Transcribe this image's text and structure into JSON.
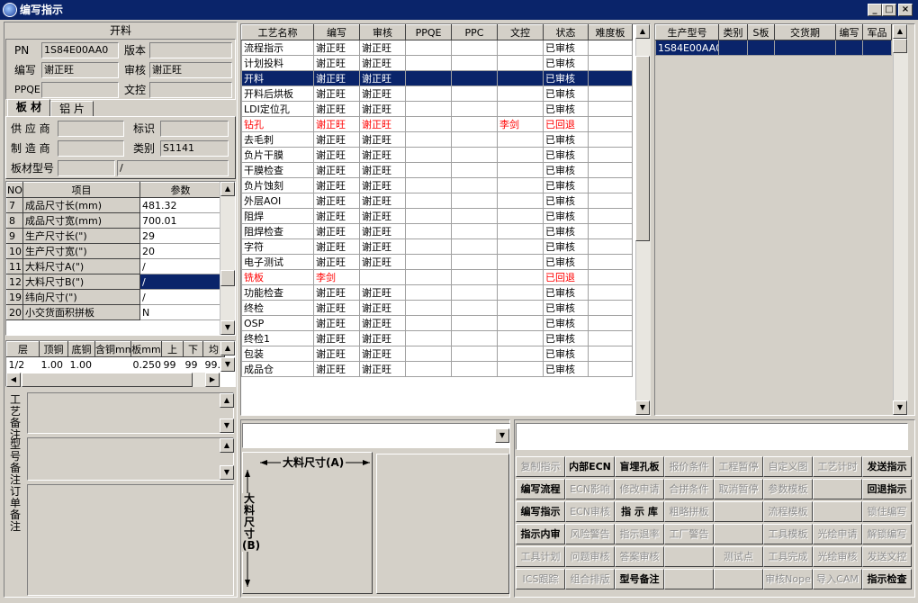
{
  "window": {
    "title": "编写指示",
    "min_label": "_",
    "max_label": "□",
    "close_label": "×"
  },
  "left": {
    "section_title": "开料",
    "pn_label": "PN",
    "pn_value": "1S84E00AA0",
    "version_label": "版本",
    "version_value": "",
    "writer_label": "编写",
    "writer_value": "谢正旺",
    "reviewer_label": "审核",
    "reviewer_value": "谢正旺",
    "ppqe_label": "PPQE",
    "ppqe_value": "",
    "doccontrol_label": "文控",
    "doccontrol_value": "",
    "tabs": [
      {
        "label": "板 材"
      },
      {
        "label": "铝 片"
      }
    ],
    "supplier_label": "供 应 商",
    "supplier_value": "",
    "mark_label": "标识",
    "mark_value": "",
    "maker_label": "制 造 商",
    "maker_value": "",
    "category_label": "类别",
    "category_value": "S1141",
    "board_model_label": "板材型号",
    "board_model_value": "",
    "board_model_value2": "/",
    "param_headers": [
      "NO",
      "项目",
      "参数"
    ],
    "params": [
      {
        "no": "7",
        "item": "成品尺寸长(mm)",
        "value": "481.32"
      },
      {
        "no": "8",
        "item": "成品尺寸宽(mm)",
        "value": "700.01"
      },
      {
        "no": "9",
        "item": "生产尺寸长(\")",
        "value": "29"
      },
      {
        "no": "10",
        "item": "生产尺寸宽(\")",
        "value": "20"
      },
      {
        "no": "11",
        "item": "大料尺寸A(\")",
        "value": "/"
      },
      {
        "no": "12",
        "item": "大料尺寸B(\")",
        "value": "/"
      },
      {
        "no": "19",
        "item": "纬向尺寸(\")",
        "value": "/"
      },
      {
        "no": "20",
        "item": "小交货面积拼板",
        "value": "N"
      }
    ],
    "layer_headers": [
      "层",
      "顶铜",
      "底铜",
      "含铜mm",
      "板mm",
      "上",
      "下",
      "均"
    ],
    "layers": [
      {
        "c0": "1/2",
        "c1": "1.00",
        "c2": "1.00",
        "c3": "",
        "c4": "0.250",
        "c5": "99",
        "c6": "99",
        "c7": "99."
      }
    ],
    "notes": [
      {
        "label": "工艺备注"
      },
      {
        "label": "型号备注"
      },
      {
        "label": "订单备注"
      }
    ]
  },
  "process": {
    "headers": [
      "工艺名称",
      "编写",
      "审核",
      "PPQE",
      "PPC",
      "文控",
      "状态",
      "难度板"
    ],
    "rows": [
      {
        "name": "流程指示",
        "writer": "谢正旺",
        "reviewer": "谢正旺",
        "ppqe": "",
        "ppc": "",
        "doc": "",
        "status": "已审核",
        "diff": ""
      },
      {
        "name": "计划投料",
        "writer": "谢正旺",
        "reviewer": "谢正旺",
        "ppqe": "",
        "ppc": "",
        "doc": "",
        "status": "已审核",
        "diff": ""
      },
      {
        "name": "开料",
        "writer": "谢正旺",
        "reviewer": "谢正旺",
        "ppqe": "",
        "ppc": "",
        "doc": "",
        "status": "已审核",
        "diff": ""
      },
      {
        "name": "开料后烘板",
        "writer": "谢正旺",
        "reviewer": "谢正旺",
        "ppqe": "",
        "ppc": "",
        "doc": "",
        "status": "已审核",
        "diff": ""
      },
      {
        "name": "LDI定位孔",
        "writer": "谢正旺",
        "reviewer": "谢正旺",
        "ppqe": "",
        "ppc": "",
        "doc": "",
        "status": "已审核",
        "diff": ""
      },
      {
        "name": "钻孔",
        "writer": "谢正旺",
        "reviewer": "谢正旺",
        "ppqe": "",
        "ppc": "",
        "doc": "李剑",
        "status": "已回退",
        "diff": ""
      },
      {
        "name": "去毛刺",
        "writer": "谢正旺",
        "reviewer": "谢正旺",
        "ppqe": "",
        "ppc": "",
        "doc": "",
        "status": "已审核",
        "diff": ""
      },
      {
        "name": "负片干膜",
        "writer": "谢正旺",
        "reviewer": "谢正旺",
        "ppqe": "",
        "ppc": "",
        "doc": "",
        "status": "已审核",
        "diff": ""
      },
      {
        "name": "干膜检查",
        "writer": "谢正旺",
        "reviewer": "谢正旺",
        "ppqe": "",
        "ppc": "",
        "doc": "",
        "status": "已审核",
        "diff": ""
      },
      {
        "name": "负片蚀刻",
        "writer": "谢正旺",
        "reviewer": "谢正旺",
        "ppqe": "",
        "ppc": "",
        "doc": "",
        "status": "已审核",
        "diff": ""
      },
      {
        "name": "外层AOI",
        "writer": "谢正旺",
        "reviewer": "谢正旺",
        "ppqe": "",
        "ppc": "",
        "doc": "",
        "status": "已审核",
        "diff": ""
      },
      {
        "name": "阻焊",
        "writer": "谢正旺",
        "reviewer": "谢正旺",
        "ppqe": "",
        "ppc": "",
        "doc": "",
        "status": "已审核",
        "diff": ""
      },
      {
        "name": "阻焊检查",
        "writer": "谢正旺",
        "reviewer": "谢正旺",
        "ppqe": "",
        "ppc": "",
        "doc": "",
        "status": "已审核",
        "diff": ""
      },
      {
        "name": "字符",
        "writer": "谢正旺",
        "reviewer": "谢正旺",
        "ppqe": "",
        "ppc": "",
        "doc": "",
        "status": "已审核",
        "diff": ""
      },
      {
        "name": "电子测试",
        "writer": "谢正旺",
        "reviewer": "谢正旺",
        "ppqe": "",
        "ppc": "",
        "doc": "",
        "status": "已审核",
        "diff": ""
      },
      {
        "name": "铣板",
        "writer": "李剑",
        "reviewer": "",
        "ppqe": "",
        "ppc": "",
        "doc": "",
        "status": "已回退",
        "diff": ""
      },
      {
        "name": "功能检查",
        "writer": "谢正旺",
        "reviewer": "谢正旺",
        "ppqe": "",
        "ppc": "",
        "doc": "",
        "status": "已审核",
        "diff": ""
      },
      {
        "name": "终检",
        "writer": "谢正旺",
        "reviewer": "谢正旺",
        "ppqe": "",
        "ppc": "",
        "doc": "",
        "status": "已审核",
        "diff": ""
      },
      {
        "name": "OSP",
        "writer": "谢正旺",
        "reviewer": "谢正旺",
        "ppqe": "",
        "ppc": "",
        "doc": "",
        "status": "已审核",
        "diff": ""
      },
      {
        "name": "终检1",
        "writer": "谢正旺",
        "reviewer": "谢正旺",
        "ppqe": "",
        "ppc": "",
        "doc": "",
        "status": "已审核",
        "diff": ""
      },
      {
        "name": "包装",
        "writer": "谢正旺",
        "reviewer": "谢正旺",
        "ppqe": "",
        "ppc": "",
        "doc": "",
        "status": "已审核",
        "diff": ""
      },
      {
        "name": "成品仓",
        "writer": "谢正旺",
        "reviewer": "谢正旺",
        "ppqe": "",
        "ppc": "",
        "doc": "",
        "status": "已审核",
        "diff": ""
      }
    ]
  },
  "orders": {
    "headers": [
      "生产型号",
      "类别",
      "S板",
      "交货期",
      "编写",
      "军品"
    ],
    "rows": [
      {
        "model": "1S84E00AA0",
        "cat": "",
        "s": "",
        "date": "",
        "writer": "",
        "mil": ""
      }
    ]
  },
  "diagram": {
    "a_label": "大料尺寸(A)",
    "b_label": "大料尺寸(B)"
  },
  "actions": [
    [
      "复制指示",
      "内部ECN",
      "盲埋孔板",
      "报价条件",
      "工程暂停",
      "自定义图",
      "工艺计时",
      "发送指示"
    ],
    [
      "编写流程",
      "ECN影响",
      "修改申请",
      "合拼条件",
      "取消暂停",
      "参数模板",
      "",
      "回退指示"
    ],
    [
      "编写指示",
      "ECN审核",
      "指 示 库",
      "粗略拼板",
      "",
      "流程模板",
      "",
      "锁住编写"
    ],
    [
      "指示内审",
      "风险警告",
      "指示退率",
      "工厂警告",
      "",
      "工具模板",
      "光绘申请",
      "解锁编写"
    ],
    [
      "工具计划",
      "问题审核",
      "答案审核",
      "",
      "测试点",
      "工具完成",
      "光绘审核",
      "发送文控"
    ],
    [
      "ICS跟踪",
      "组合排版",
      "型号备注",
      "",
      "",
      "审核Nope",
      "导入CAM",
      "指示检查"
    ]
  ],
  "actions_enabled": [
    [
      false,
      true,
      true,
      false,
      false,
      false,
      false,
      true
    ],
    [
      true,
      false,
      false,
      false,
      false,
      false,
      false,
      true
    ],
    [
      true,
      false,
      true,
      false,
      false,
      false,
      false,
      false
    ],
    [
      true,
      false,
      false,
      false,
      false,
      false,
      false,
      false
    ],
    [
      false,
      false,
      false,
      false,
      false,
      false,
      false,
      false
    ],
    [
      false,
      false,
      true,
      false,
      false,
      false,
      false,
      true
    ]
  ]
}
